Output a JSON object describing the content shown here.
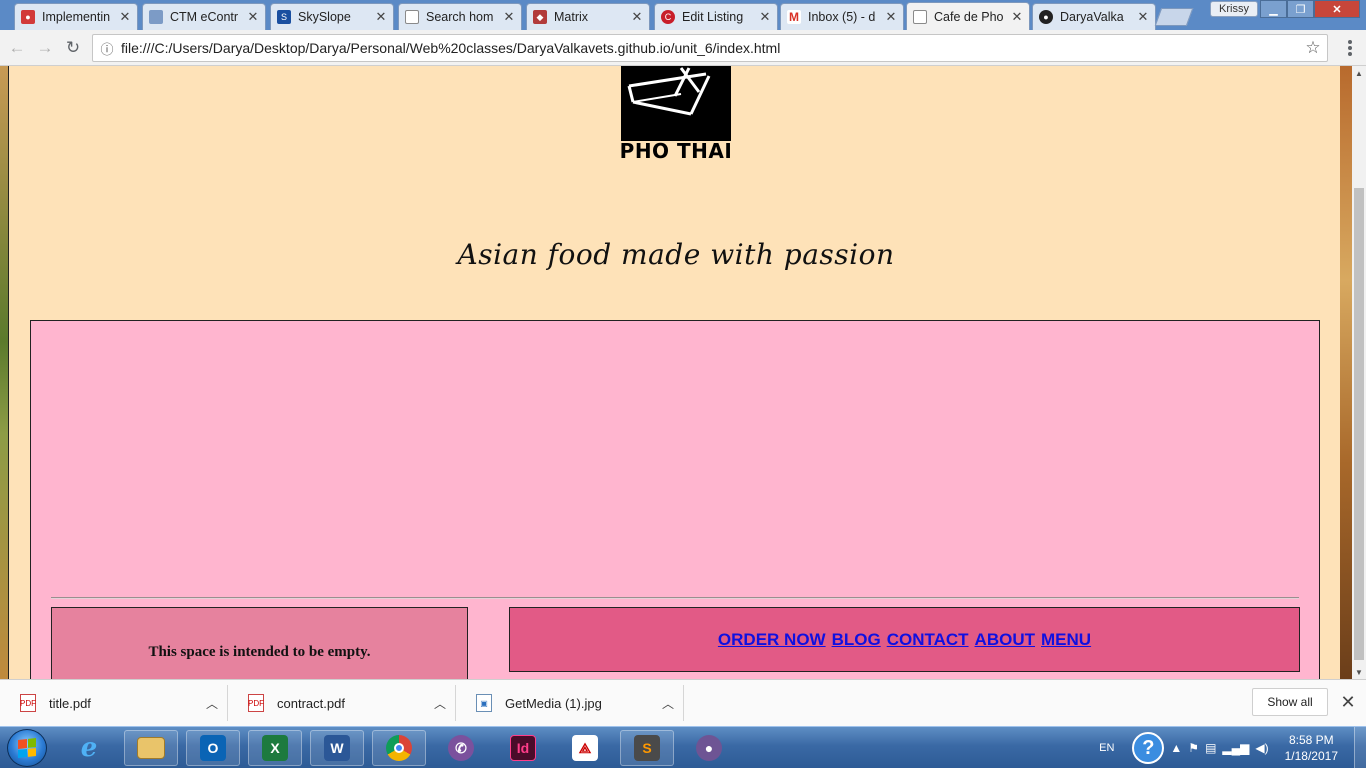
{
  "browser": {
    "tabs": [
      {
        "label": "Implementin",
        "icon": "red-circle-icon",
        "color": "#d23a3a"
      },
      {
        "label": "CTM eContr",
        "icon": "page-icon",
        "color": "#7c9bc6"
      },
      {
        "label": "SkySlope",
        "icon": "skyslope-icon",
        "color": "#1a4fa0"
      },
      {
        "label": "Search hom",
        "icon": "page-icon",
        "color": "#8a8a8a"
      },
      {
        "label": "Matrix",
        "icon": "matrix-icon",
        "color": "#b23b3b"
      },
      {
        "label": "Edit Listing",
        "icon": "edit-icon",
        "color": "#c81e2a"
      },
      {
        "label": "Inbox (5) - d",
        "icon": "gmail-icon",
        "color": "#d93025"
      },
      {
        "label": "Cafe de Pho",
        "icon": "page-icon",
        "color": "#8a8a8a"
      },
      {
        "label": "DaryaValka",
        "icon": "github-icon",
        "color": "#222222"
      }
    ],
    "profile_name": "Krissy",
    "url": "file:///C:/Users/Darya/Desktop/Darya/Personal/Web%20classes/DaryaValkavets.github.io/unit_6/index.html"
  },
  "page": {
    "logo_text": "PHO THAI",
    "tagline": "Asian food made with passion",
    "empty_note": "This space is intended to be empty.",
    "nav": [
      "ORDER NOW",
      "BLOG",
      "CONTACT",
      "ABOUT",
      "MENU"
    ]
  },
  "downloads": {
    "items": [
      "title.pdf",
      "contract.pdf",
      "GetMedia (1).jpg"
    ],
    "show_all": "Show all"
  },
  "taskbar": {
    "apps": [
      "internet-explorer-icon",
      "file-explorer-icon",
      "outlook-icon",
      "excel-icon",
      "word-icon",
      "chrome-icon",
      "viber-icon",
      "indesign-icon",
      "acrobat-icon",
      "sublime-text-icon",
      "github-desktop-icon"
    ],
    "language": "EN",
    "time": "8:58 PM",
    "date": "1/18/2017"
  },
  "colors": {
    "page_bg": "#fee2b8",
    "pink_box": "#ffb5cf",
    "empty_box": "#e6829e",
    "nav_box": "#e25a86",
    "link": "#1010e0"
  }
}
